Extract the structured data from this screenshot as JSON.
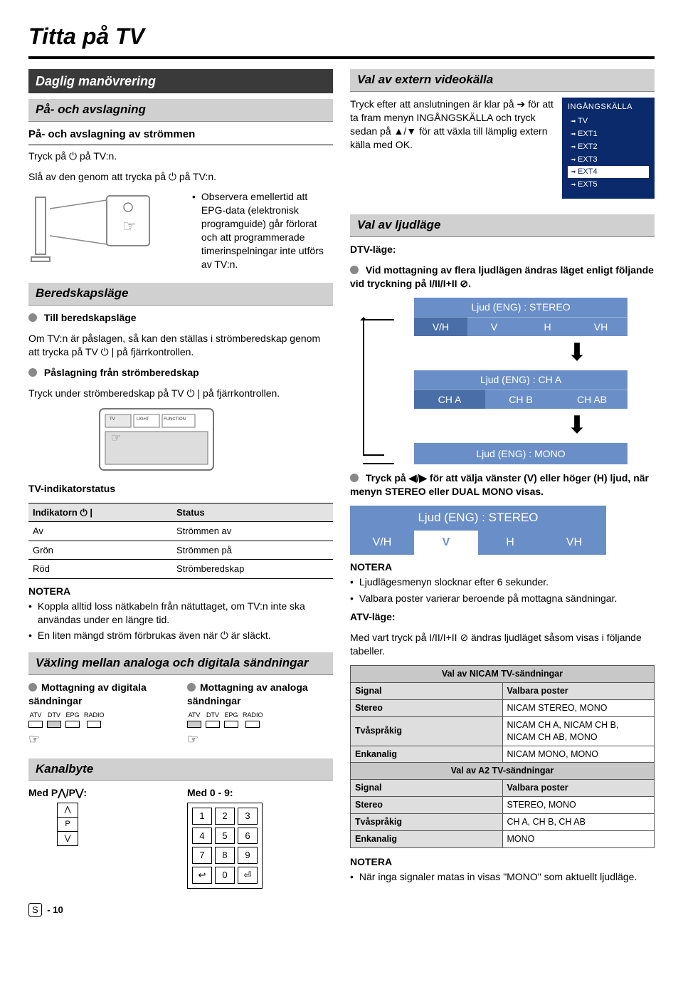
{
  "title": "Titta på TV",
  "left": {
    "daily": "Daglig manövrering",
    "onoff": "På- och avslagning",
    "onoff_sub": "På- och avslagning av strömmen",
    "onoff_l1": "Tryck på ⏻ på TV:n.",
    "onoff_l2": "Slå av den genom att trycka på ⏻ på TV:n.",
    "epg_note": "Observera emellertid att EPG-data (elektronisk programguide) går förlorat och att programmerade timerinspelningar inte utförs av TV:n.",
    "standby": "Beredskapsläge",
    "to_standby": "Till beredskapsläge",
    "to_standby_body": "Om TV:n är påslagen, så kan den ställas i strömberedskap genom att trycka på TV ⏻ | på fjärrkontrollen.",
    "from_standby": "Påslagning från strömberedskap",
    "from_standby_body": "Tryck under strömberedskap på TV ⏻ | på fjärrkontrollen.",
    "remote_labels": {
      "tv": "TV",
      "light": "LIGHT",
      "func": "FUNCTION"
    },
    "indicator_head": "TV-indikatorstatus",
    "indicator_table": {
      "col1": "Indikatorn ⏻ |",
      "col2": "Status",
      "rows": [
        [
          "Av",
          "Strömmen av"
        ],
        [
          "Grön",
          "Strömmen på"
        ],
        [
          "Röd",
          "Strömberedskap"
        ]
      ]
    },
    "note": "NOTERA",
    "note1": "Koppla alltid loss nätkabeln från nätuttaget, om TV:n inte ska användas under en längre tid.",
    "note2": "En liten mängd ström förbrukas även när ⏻ är släckt.",
    "switch": "Växling mellan analoga och digitala sändningar",
    "recv_dig": "Mottagning av digitala sändningar",
    "recv_ana": "Mottagning av analoga sändningar",
    "atv_labels": [
      "ATV",
      "DTV",
      "EPG",
      "RADIO"
    ],
    "chan": "Kanalbyte",
    "chan_p": "Med P⋀/P⋁:",
    "chan_num": "Med 0 - 9:",
    "keypad": [
      "1",
      "2",
      "3",
      "4",
      "5",
      "6",
      "7",
      "8",
      "9",
      "↩",
      "0",
      "⏎"
    ]
  },
  "right": {
    "ext": "Val av extern videokälla",
    "ext_body": "Tryck efter att anslutningen är klar på ➔ för att ta fram menyn INGÅNGSKÄLLA och tryck sedan på ▲/▼ för att växla till lämplig extern källa med OK.",
    "src_title": "INGÅNGSKÄLLA",
    "src_items": [
      "TV",
      "EXT1",
      "EXT2",
      "EXT3",
      "EXT4",
      "EXT5"
    ],
    "src_selected_index": 4,
    "audio": "Val av ljudläge",
    "dtv": "DTV-läge:",
    "dtv_head": "Vid mottagning av flera ljudlägen ändras läget enligt följande vid tryckning på I/II/I+II ⊘.",
    "stereo_head": "Ljud (ENG) : STEREO",
    "stereo_row": [
      "V/H",
      "V",
      "H",
      "VH"
    ],
    "cha_head": "Ljud (ENG) : CH A",
    "cha_row": [
      "CH A",
      "CH B",
      "CH AB"
    ],
    "mono": "Ljud (ENG) : MONO",
    "lr_head": "Tryck på ◀/▶ för att välja vänster (V) eller höger (H) ljud, när menyn STEREO eller DUAL MONO visas.",
    "wide_head": "Ljud (ENG) : STEREO",
    "wide_row": [
      "V/H",
      "V",
      "H",
      "VH"
    ],
    "note": "NOTERA",
    "note_a1": "Ljudlägesmenyn slocknar efter 6 sekunder.",
    "note_a2": "Valbara poster varierar beroende på mottagna sändningar.",
    "atv": "ATV-läge:",
    "atv_body": "Med vart tryck på I/II/I+II ⊘ ändras ljudläget såsom visas i följande tabeller.",
    "nicam_title": "Val av NICAM TV-sändningar",
    "sig_col1": "Signal",
    "sig_col2": "Valbara poster",
    "nicam_rows": [
      [
        "Stereo",
        "NICAM STEREO, MONO"
      ],
      [
        "Tvåspråkig",
        "NICAM CH A, NICAM CH B, NICAM CH AB, MONO"
      ],
      [
        "Enkanalig",
        "NICAM MONO, MONO"
      ]
    ],
    "a2_title": "Val av A2 TV-sändningar",
    "a2_rows": [
      [
        "Stereo",
        "STEREO, MONO"
      ],
      [
        "Tvåspråkig",
        "CH A, CH B, CH AB"
      ],
      [
        "Enkanalig",
        "MONO"
      ]
    ],
    "note_b": "När inga signaler matas in visas \"MONO\" som aktuellt ljudläge."
  },
  "footer": {
    "s": "S",
    "page": "- 10"
  }
}
